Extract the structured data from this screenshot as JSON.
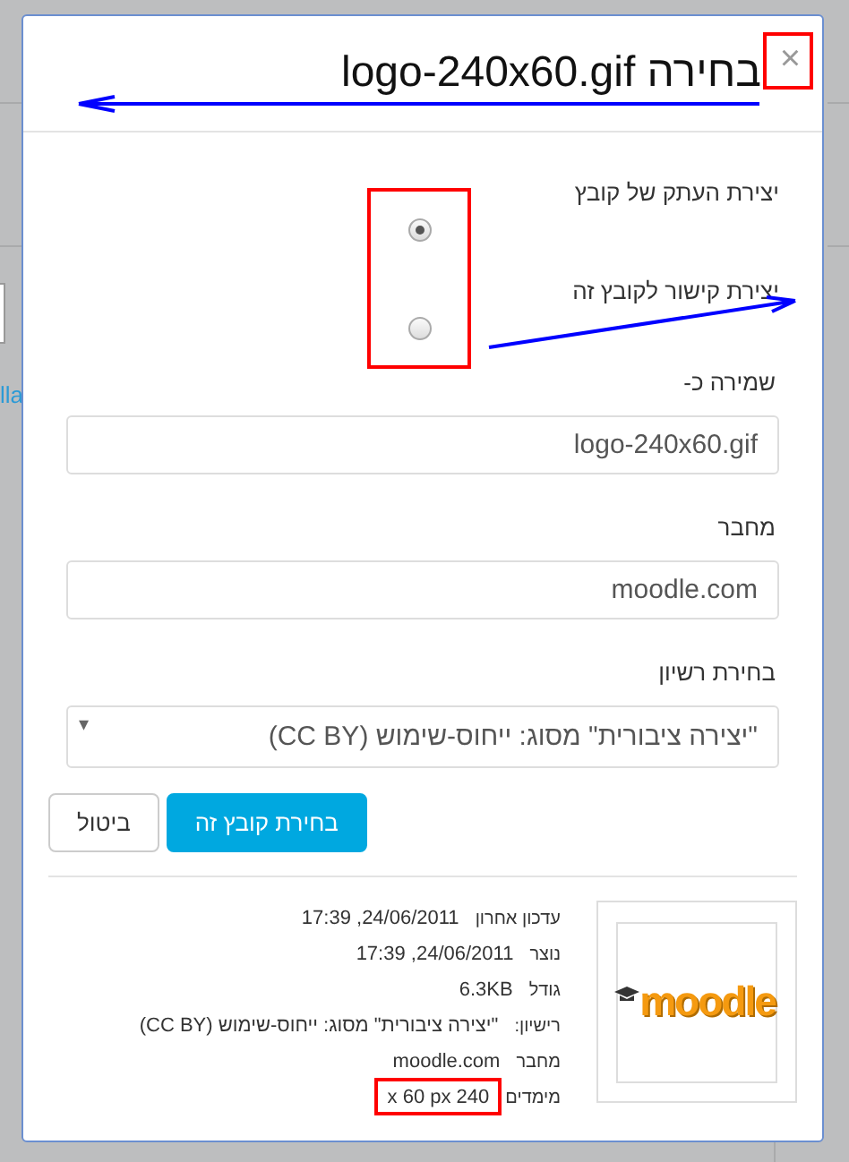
{
  "background": {
    "link_text": "lla"
  },
  "dialog": {
    "title": "בחירה logo-240x60.gif",
    "close": "×"
  },
  "options": [
    {
      "label": "יצירת העתק של קובץ",
      "selected": true
    },
    {
      "label": "יצירת קישור לקובץ זה",
      "selected": false
    }
  ],
  "fields": [
    {
      "label": "שמירה כ-",
      "kind": "text",
      "value": "logo-240x60.gif"
    },
    {
      "label": "מחבר",
      "kind": "text",
      "value": "moodle.com"
    },
    {
      "label": "בחירת רשיון",
      "kind": "select",
      "value": "\"יצירה ציבורית\" מסוג: ייחוס-שימוש (CC BY)",
      "arrow": "▾"
    }
  ],
  "buttons": [
    {
      "label": "בחירת קובץ זה",
      "kind": "primary"
    },
    {
      "label": "ביטול",
      "kind": "secondary"
    }
  ],
  "preview": {
    "logo_text": "moodle"
  },
  "details": [
    {
      "label": "עדכון אחרון",
      "value": "24/06/2011, 17:39"
    },
    {
      "label": "נוצר",
      "value": "24/06/2011, 17:39"
    },
    {
      "label": "גודל",
      "value": "6.3KB"
    },
    {
      "label": "רישיון:",
      "value": "\"יצירה ציבורית\" מסוג: ייחוס-שימוש (CC BY)"
    },
    {
      "label": "מחבר",
      "value": "moodle.com"
    },
    {
      "label": "מימדים",
      "value": "x 60 px 240"
    }
  ]
}
